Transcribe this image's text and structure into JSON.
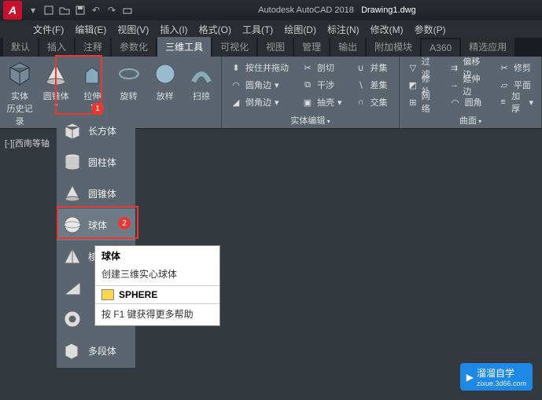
{
  "title": {
    "app": "Autodesk AutoCAD 2018",
    "file": "Drawing1.dwg"
  },
  "menubar": [
    "文件(F)",
    "编辑(E)",
    "视图(V)",
    "插入(I)",
    "格式(O)",
    "工具(T)",
    "绘图(D)",
    "标注(N)",
    "修改(M)",
    "参数(P)"
  ],
  "tabs": [
    "默认",
    "插入",
    "注释",
    "参数化",
    "三维工具",
    "可视化",
    "视图",
    "管理",
    "输出",
    "附加模块",
    "A360",
    "精选应用"
  ],
  "tabs_active_index": 4,
  "ribbon": {
    "panel1": {
      "btn1": "实体\n历史记录",
      "btn2": "圆锥体",
      "btn3": "拉伸",
      "btn4": "旋转",
      "btn5": "放样",
      "btn6": "扫掠"
    },
    "panel2": {
      "title": "实体编辑",
      "rows": [
        [
          "按住并拖动",
          "剖切",
          "并集",
          "过滤",
          "偏移边",
          "修剪"
        ],
        [
          "圆角边",
          "干涉",
          "差集",
          "修补",
          "延伸边",
          "平面"
        ],
        [
          "倒角边",
          "抽壳",
          "交集",
          "网络",
          "圆角",
          "加厚"
        ]
      ]
    },
    "panel3_title": "曲面"
  },
  "viewport_label": "[-][西南等轴",
  "dropdown": {
    "items": [
      "长方体",
      "圆柱体",
      "圆锥体",
      "球体",
      "棱",
      "",
      "",
      "多段体"
    ]
  },
  "tooltip": {
    "title": "球体",
    "desc": "创建三维实心球体",
    "cmd": "SPHERE",
    "help": "按 F1 键获得更多帮助"
  },
  "badges": {
    "one": "1",
    "two": "2"
  },
  "watermark": {
    "text": "溜溜自学",
    "sub": "zixue.3d66.com"
  }
}
